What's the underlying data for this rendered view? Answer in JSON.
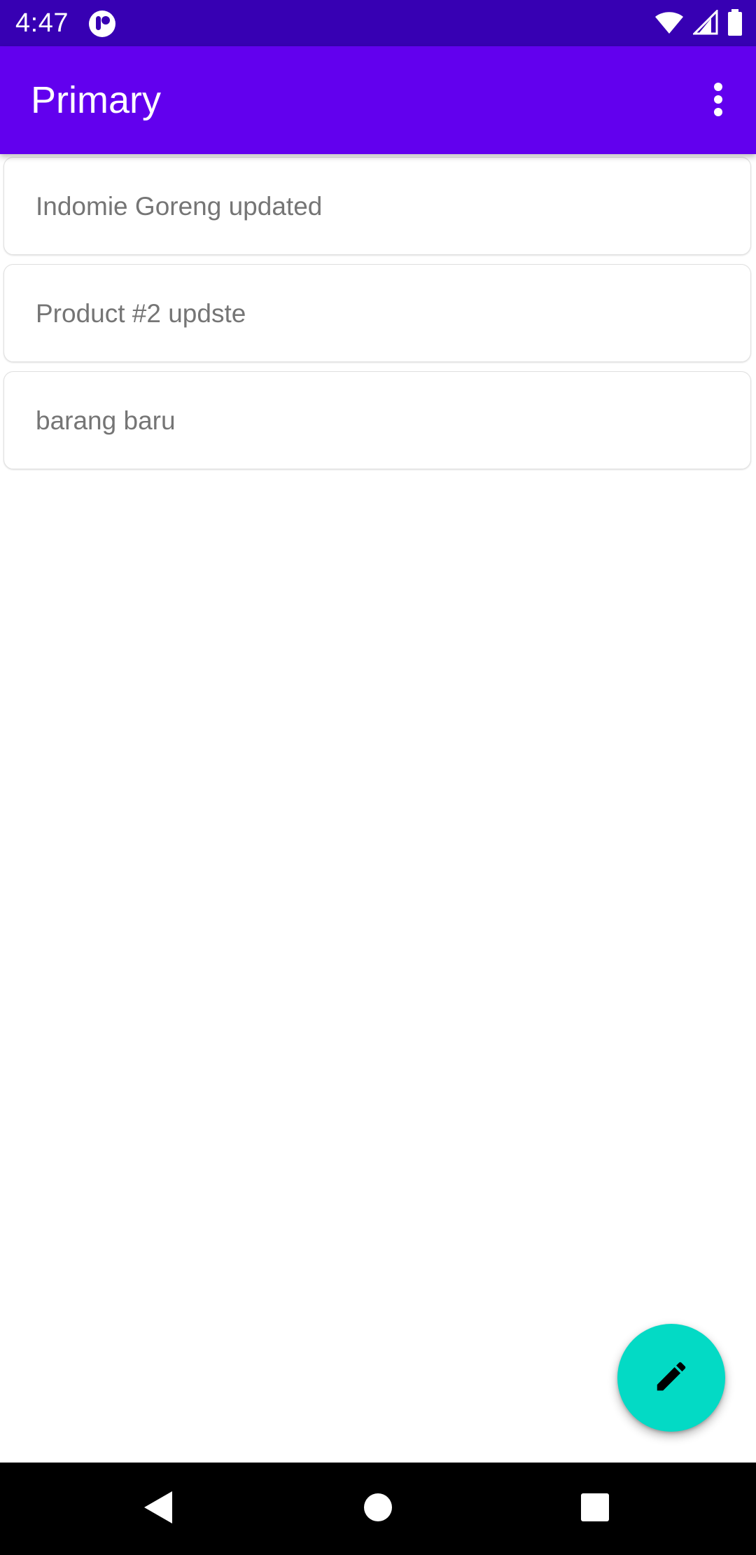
{
  "status_bar": {
    "time": "4:47",
    "icons": [
      "app-notification-icon",
      "wifi-icon",
      "signal-icon",
      "battery-icon"
    ],
    "background": "#3700b3"
  },
  "app_bar": {
    "title": "Primary",
    "overflow_icon": "more-vert-icon",
    "background": "#6200ee"
  },
  "list": {
    "items": [
      {
        "label": "Indomie Goreng updated"
      },
      {
        "label": "Product #2 updste"
      },
      {
        "label": "barang baru"
      }
    ]
  },
  "fab": {
    "icon": "edit-pencil-icon",
    "color": "#03dac5"
  },
  "nav_bar": {
    "buttons": [
      "back-icon",
      "home-icon",
      "recents-icon"
    ]
  }
}
